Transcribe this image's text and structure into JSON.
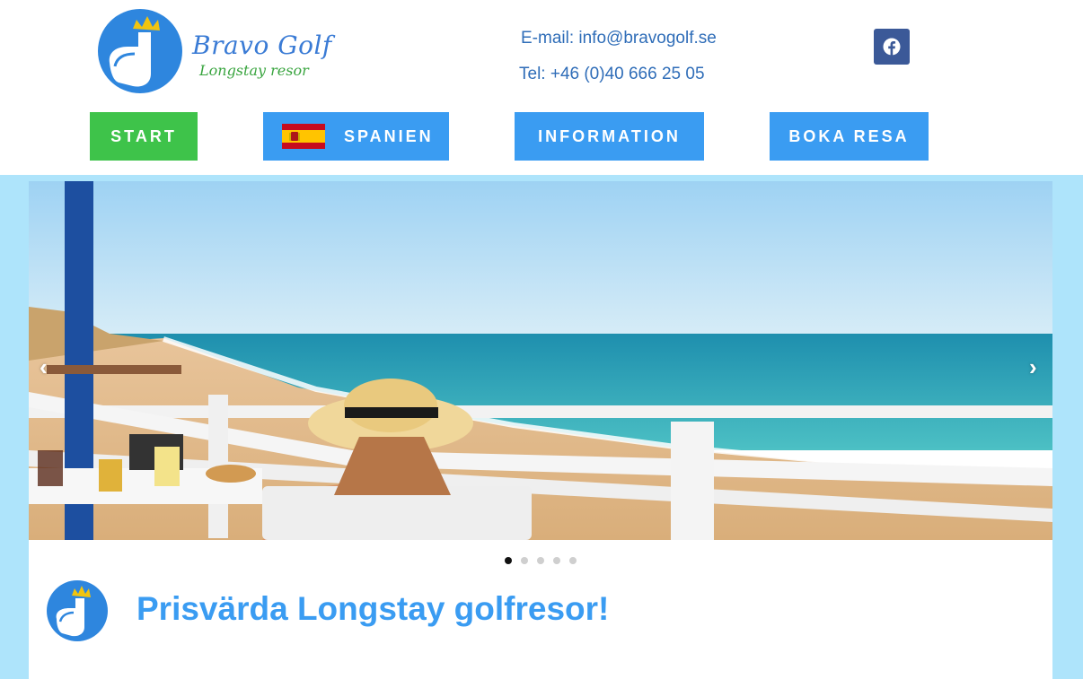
{
  "header": {
    "logo_title": "Bravo Golf",
    "logo_subtitle": "Longstay resor",
    "email": "E-mail: info@bravogolf.se",
    "tel": "Tel: +46 (0)40 666 25 05"
  },
  "nav": {
    "start": "START",
    "spanien": "SPANIEN",
    "information": "INFORMATION",
    "boka": "BOKA RESA"
  },
  "slider": {
    "prev": "‹",
    "next": "›",
    "dot_count": 5,
    "active_dot": 1
  },
  "main": {
    "heading": "Prisvärda Longstay golfresor!"
  },
  "colors": {
    "nav_green": "#3ec34a",
    "nav_blue": "#3a9cf2",
    "band": "#aee4fb",
    "facebook": "#3b5998",
    "heading": "#3a9cf2"
  },
  "icons": {
    "logo": "golf-club-crown-icon",
    "facebook": "facebook-icon",
    "flag": "spain-flag-icon"
  }
}
